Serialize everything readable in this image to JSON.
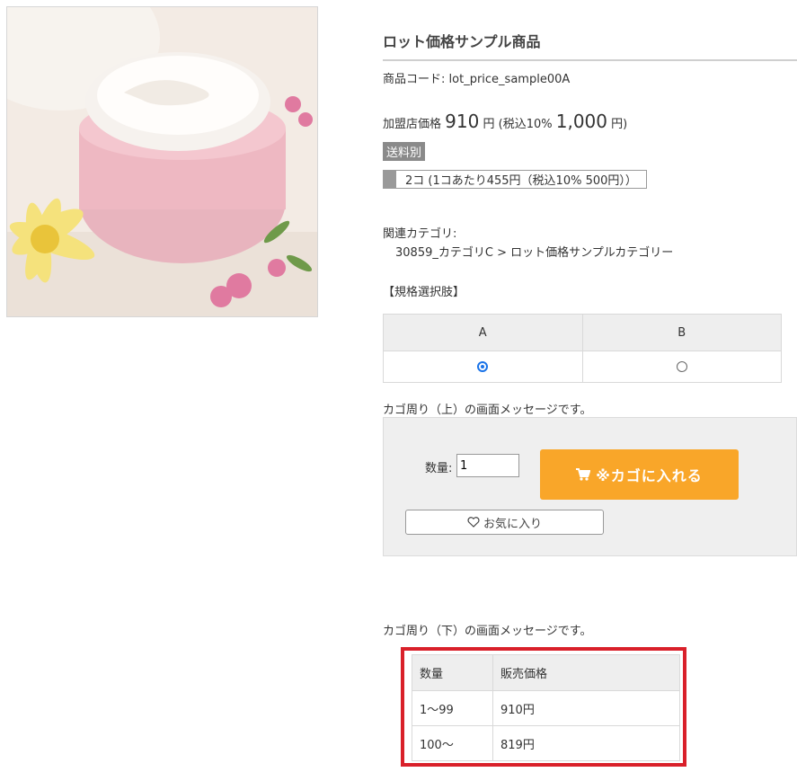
{
  "product": {
    "title": "ロット価格サンプル商品",
    "code_label": "商品コード:",
    "code_value": "lot_price_sample00A",
    "price_label": "加盟店価格",
    "price": "910",
    "yen": "円",
    "tax_label": "(税込10%",
    "tax_price": "1,000",
    "tax_yen": "円)",
    "shipping_badge": "送料別",
    "lot_text": "2コ (1コあたり455円（税込10% 500円））"
  },
  "category": {
    "label": "関連カテゴリ:",
    "path": "30859_カテゴリC > ロット価格サンプルカテゴリー"
  },
  "spec": {
    "label": "【規格選択肢】",
    "options": [
      {
        "name": "A",
        "selected": true
      },
      {
        "name": "B",
        "selected": false
      }
    ]
  },
  "cart": {
    "message_top": "カゴ周り（上）の画面メッセージです。",
    "qty_label": "数量:",
    "qty_value": "1",
    "add_to_cart_label": "※カゴに入れる",
    "favorite_label": "お気に入り",
    "message_bottom": "カゴ周り（下）の画面メッセージです。",
    "button_color": "#f9a629"
  },
  "price_tiers": {
    "headers": [
      "数量",
      "販売価格"
    ],
    "rows": [
      [
        "1〜99",
        "910円"
      ],
      [
        "100〜",
        "819円"
      ]
    ],
    "highlight_color": "#d9202a"
  },
  "icons": {
    "cart": "cart-icon",
    "heart": "heart-icon"
  }
}
